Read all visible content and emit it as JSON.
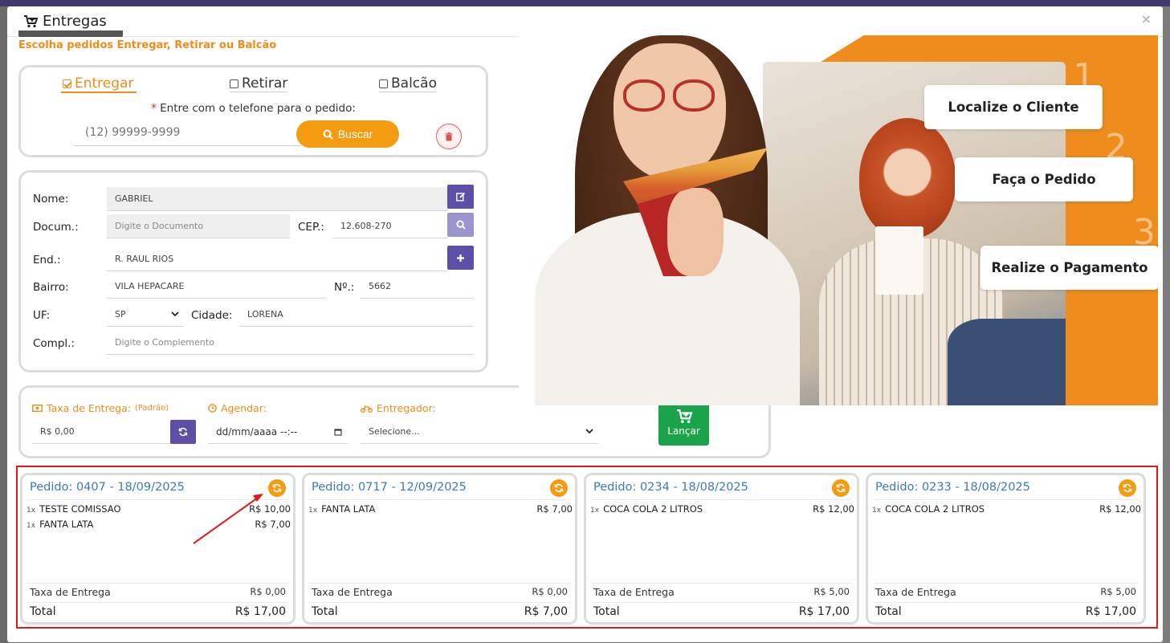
{
  "modal": {
    "title": "Entregas",
    "close_label": "×",
    "subtitle": "Escolha pedidos Entregar, Retirar ou Balcão"
  },
  "mode_tabs": [
    {
      "label": "Entregar",
      "checked": true
    },
    {
      "label": "Retirar",
      "checked": false
    },
    {
      "label": "Balcão",
      "checked": false
    }
  ],
  "phone": {
    "required_mark": "*",
    "label": "Entre com o telefone para o pedido:",
    "placeholder": "(12) 99999-9999",
    "search_label": "Buscar"
  },
  "customer": {
    "name_label": "Nome:",
    "name_value": "GABRIEL",
    "doc_label": "Docum.:",
    "doc_placeholder": "Digite o Documento",
    "cep_label": "CEP.:",
    "cep_value": "12.608-270",
    "address_label": "End.:",
    "address_value": "R. RAUL RIOS",
    "district_label": "Bairro:",
    "district_value": "VILA HEPACARE",
    "number_label": "Nº.:",
    "number_value": "5662",
    "uf_label": "UF:",
    "uf_value": "SP",
    "city_label": "Cidade:",
    "city_value": "LORENA",
    "complement_label": "Compl.:",
    "complement_placeholder": "Digite o Complemento"
  },
  "options": {
    "fee_label": "Taxa de Entrega:",
    "fee_note": "(Padrão)",
    "fee_value": "R$ 0,00",
    "schedule_label": "Agendar:",
    "schedule_placeholder": "dd/mm/aaaa --:--",
    "courier_label": "Entregador:",
    "courier_value": "Selecione...",
    "launch_label": "Lançar"
  },
  "steps": [
    {
      "num": "1",
      "label": "Localize o Cliente"
    },
    {
      "num": "2",
      "label": "Faça o Pedido"
    },
    {
      "num": "3",
      "label": "Realize o Pagamento"
    }
  ],
  "orders": [
    {
      "title": "Pedido: 0407 - 18/09/2025",
      "items": [
        {
          "qty": "1x",
          "name": "TESTE COMISSAO",
          "price": "R$ 10,00"
        },
        {
          "qty": "1x",
          "name": "FANTA LATA",
          "price": "R$ 7,00"
        }
      ],
      "fee_label": "Taxa de Entrega",
      "fee": "R$ 0,00",
      "total_label": "Total",
      "total": "R$ 17,00"
    },
    {
      "title": "Pedido: 0717 - 12/09/2025",
      "items": [
        {
          "qty": "1x",
          "name": "FANTA LATA",
          "price": "R$ 7,00"
        }
      ],
      "fee_label": "Taxa de Entrega",
      "fee": "R$ 0,00",
      "total_label": "Total",
      "total": "R$ 7,00"
    },
    {
      "title": "Pedido: 0234 - 18/08/2025",
      "items": [
        {
          "qty": "1x",
          "name": "COCA COLA 2 LITROS",
          "price": "R$ 12,00"
        }
      ],
      "fee_label": "Taxa de Entrega",
      "fee": "R$ 5,00",
      "total_label": "Total",
      "total": "R$ 17,00"
    },
    {
      "title": "Pedido: 0233 - 18/08/2025",
      "items": [
        {
          "qty": "1x",
          "name": "COCA COLA 2 LITROS",
          "price": "R$ 12,00"
        }
      ],
      "fee_label": "Taxa de Entrega",
      "fee": "R$ 5,00",
      "total_label": "Total",
      "total": "R$ 17,00"
    }
  ],
  "colors": {
    "accent": "#f39c12",
    "primary": "#5b4fa8",
    "success": "#1aa34a",
    "order_title": "#3a7bbf",
    "highlight": "#e31818"
  },
  "icons": [
    "cart-plus-icon",
    "search-icon",
    "trash-icon",
    "edit-icon",
    "plus-icon",
    "refresh-icon",
    "money-icon",
    "clock-icon",
    "motorcycle-icon",
    "chevron-down-icon",
    "calendar-icon",
    "check-square-icon",
    "square-icon",
    "close-icon"
  ]
}
